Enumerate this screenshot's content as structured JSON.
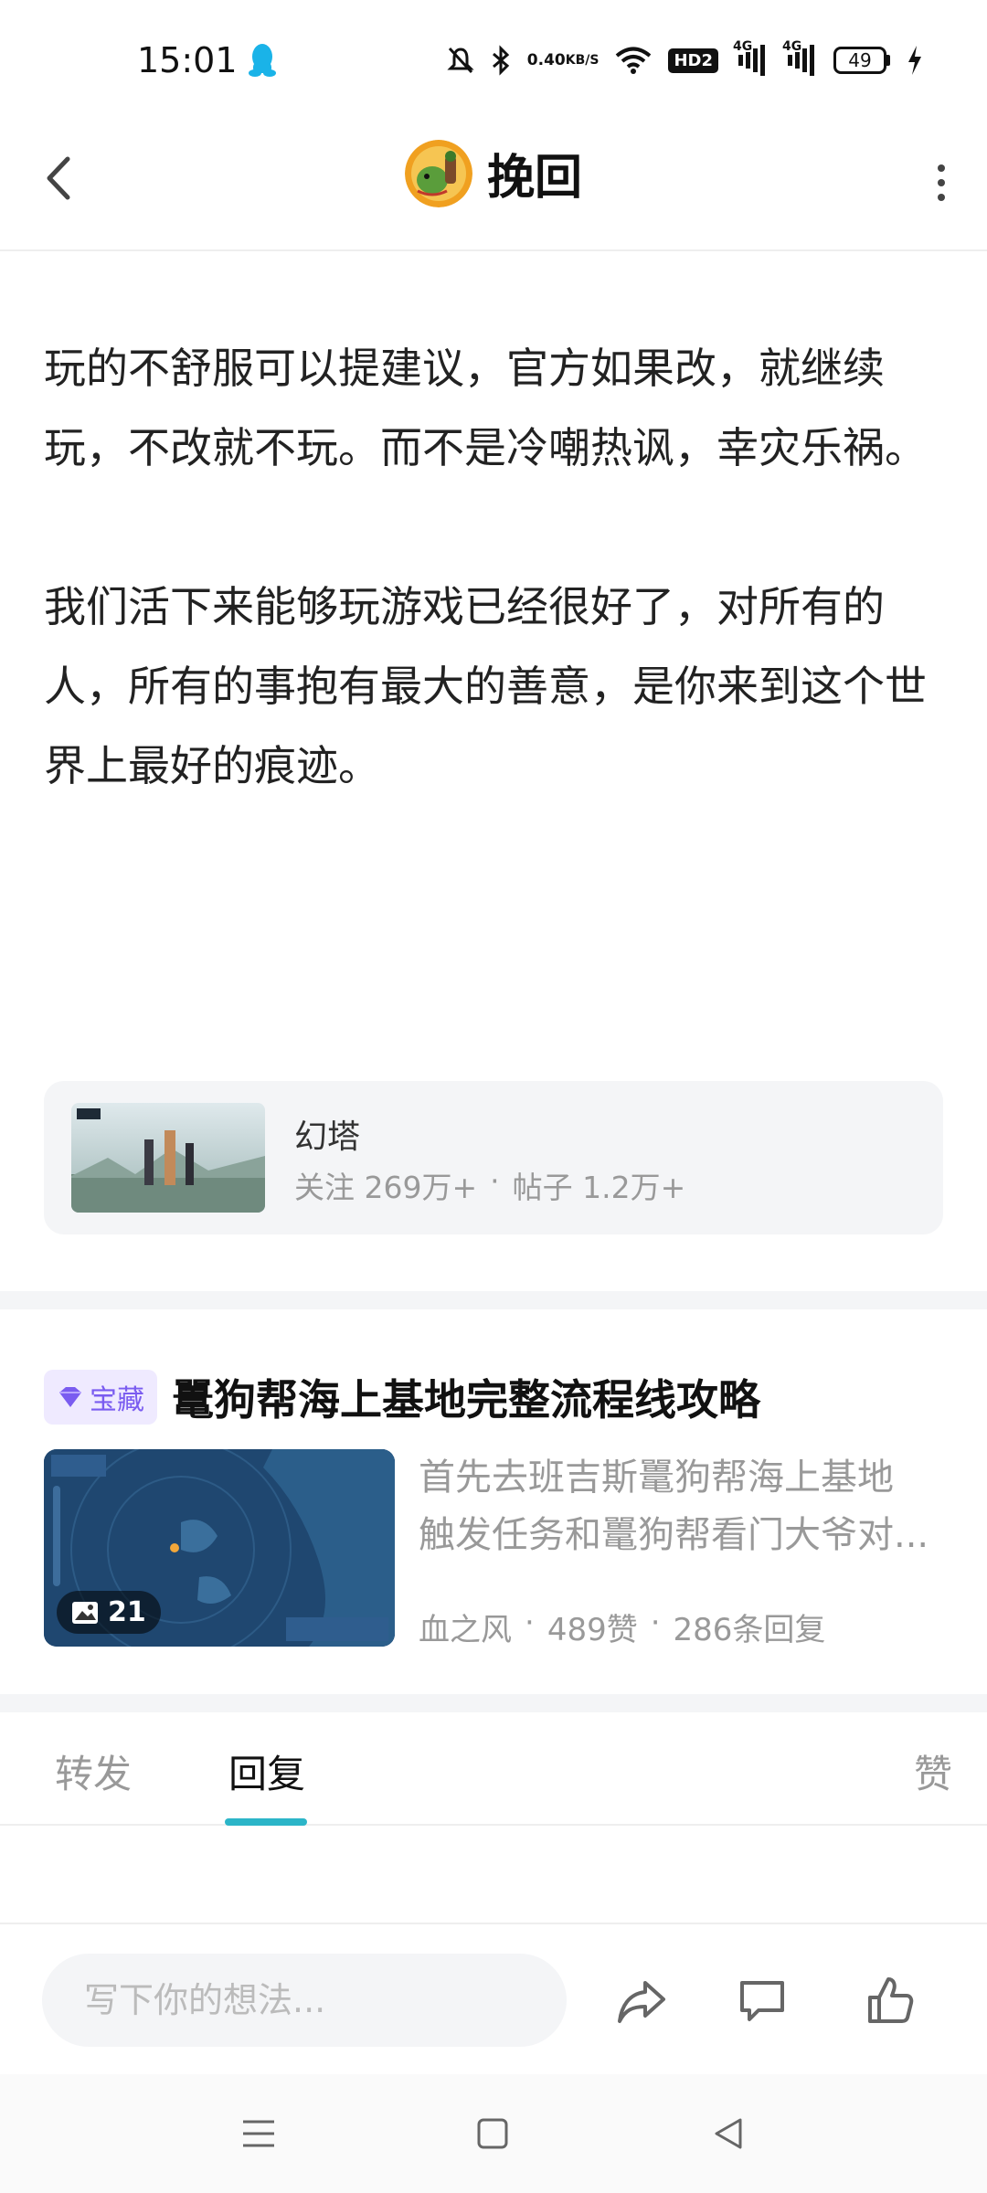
{
  "status_bar": {
    "time": "15:01",
    "net_speed_value": "0.40",
    "net_speed_unit": "KB/S",
    "hd_label": "HD2",
    "signal1_label": "4G",
    "signal2_label": "4G",
    "battery": "49",
    "icons": [
      "qq-icon",
      "mute-icon",
      "bluetooth-icon",
      "wifi-icon",
      "hd-icon",
      "signal-icon",
      "battery-icon",
      "charging-icon"
    ]
  },
  "header": {
    "title": "挽回"
  },
  "post": {
    "paragraphs": [
      "玩的不舒服可以提建议，官方如果改，就继续玩，不改就不玩。而不是冷嘲热讽，幸灾乐祸。",
      "我们活下来能够玩游戏已经很好了，对所有的人，所有的事抱有最大的善意，是你来到这个世界上最好的痕迹。"
    ]
  },
  "forum": {
    "name": "幻塔",
    "follow": "关注 269万+",
    "separator": "·",
    "posts": "帖子 1.2万+"
  },
  "recommended": {
    "badge": "宝藏",
    "title": "鼍狗帮海上基地完整流程线攻略",
    "excerpt_line1": "首先去班吉斯鼍狗帮海上基地",
    "excerpt_line2": "触发任务和鼍狗帮看门大爷对...",
    "image_count": "21",
    "author": "血之风",
    "separator": "·",
    "likes": "489赞",
    "replies": "286条回复"
  },
  "tabs": {
    "forward": "转发",
    "reply": "回复",
    "like": "赞",
    "active": "reply"
  },
  "input_bar": {
    "placeholder": "写下你的想法..."
  },
  "colors": {
    "accent": "#2bb5c8",
    "badge_purple": "#7a5cf0",
    "muted_text": "#999999"
  }
}
